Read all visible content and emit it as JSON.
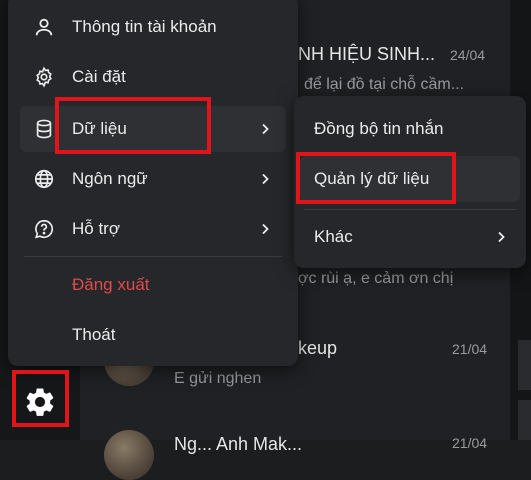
{
  "menu": {
    "items": [
      {
        "label": "Thông tin tài khoản",
        "icon": "person-icon"
      },
      {
        "label": "Cài đặt",
        "icon": "gear-icon"
      },
      {
        "label": "Dữ liệu",
        "icon": "database-icon"
      },
      {
        "label": "Ngôn ngữ",
        "icon": "globe-icon"
      },
      {
        "label": "Hỗ trợ",
        "icon": "help-icon"
      },
      {
        "label": "Đăng xuất"
      },
      {
        "label": "Thoát"
      }
    ]
  },
  "submenu": {
    "items": [
      {
        "label": "Đồng bộ tin nhắn"
      },
      {
        "label": "Quản lý dữ liệu"
      },
      {
        "label": "Khác"
      }
    ]
  },
  "conversations": [
    {
      "name": "NH HIỆU SINH...",
      "date": "24/04",
      "preview": "để lại đồ tại chỗ cầm..."
    },
    {
      "preview": "ợc rùi ạ, e cảm ơn chị"
    },
    {
      "name": "keup",
      "date": "21/04",
      "preview": "E gửi nghen"
    },
    {
      "name": "Ng... Anh Mak...",
      "date": "21/04"
    }
  ],
  "colors": {
    "highlight": "#e0141b",
    "danger": "#e04a4a",
    "menu_bg": "#26272a"
  }
}
